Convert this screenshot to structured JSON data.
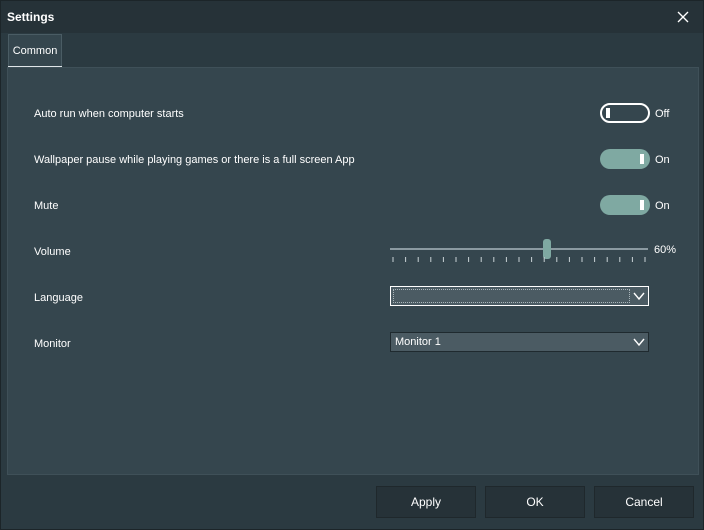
{
  "window": {
    "title": "Settings"
  },
  "tabs": [
    {
      "label": "Common",
      "active": true
    }
  ],
  "settings": {
    "auto_run": {
      "label": "Auto run when computer starts",
      "state_text": "Off",
      "on": false
    },
    "wallpaper_pause": {
      "label": "Wallpaper pause while playing games or there is a full screen App",
      "state_text": "On",
      "on": true
    },
    "mute": {
      "label": "Mute",
      "state_text": "On",
      "on": true
    },
    "volume": {
      "label": "Volume",
      "value_text": "60%",
      "value": 60,
      "min": 0,
      "max": 100
    },
    "language": {
      "label": "Language",
      "value": ""
    },
    "monitor": {
      "label": "Monitor",
      "value": "Monitor 1"
    }
  },
  "footer": {
    "apply_label": "Apply",
    "ok_label": "OK",
    "cancel_label": "Cancel"
  },
  "colors": {
    "accent": "#7fa9a2",
    "background": "#2b3a41",
    "panel": "#35464e",
    "titlebar": "#263238"
  },
  "icons": {
    "close": "close-icon",
    "dropdown": "chevron-down-icon"
  }
}
